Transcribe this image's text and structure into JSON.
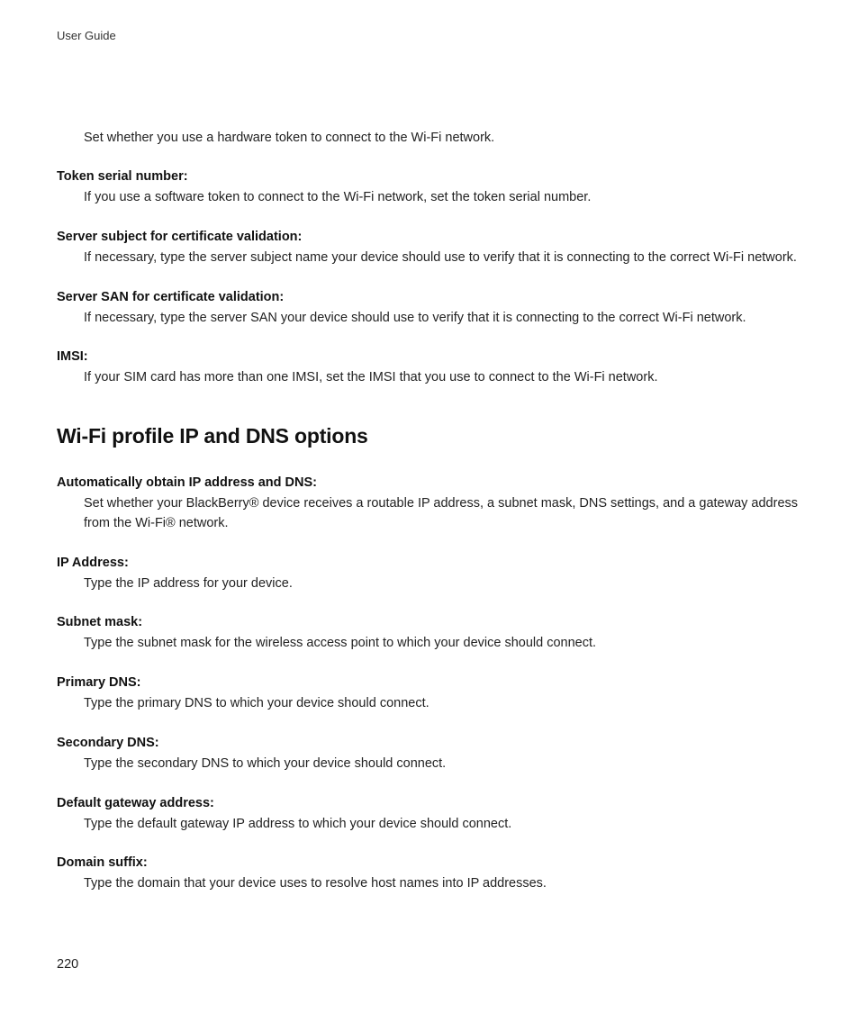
{
  "header": "User Guide",
  "orphan_desc": "Set whether you use a hardware token to connect to the Wi-Fi network.",
  "items1": [
    {
      "label": "Token serial number:",
      "desc": "If you use a software token to connect to the Wi-Fi network, set the token serial number."
    },
    {
      "label": "Server subject for certificate validation:",
      "desc": "If necessary, type the server subject name your device should use to verify that it is connecting to the correct Wi-Fi network."
    },
    {
      "label": "Server SAN for certificate validation:",
      "desc": "If necessary, type the server SAN your device should use to verify that it is connecting to the correct Wi-Fi network."
    },
    {
      "label": "IMSI:",
      "desc": "If your SIM card has more than one IMSI, set the IMSI that you use to connect to the Wi-Fi network."
    }
  ],
  "section_heading": "Wi-Fi profile IP and DNS options",
  "items2": [
    {
      "label": "Automatically obtain IP address and DNS:",
      "desc": "Set whether your BlackBerry® device receives a routable IP address, a subnet mask, DNS settings, and a gateway address from the Wi-Fi® network."
    },
    {
      "label": "IP Address:",
      "desc": "Type the IP address for your device."
    },
    {
      "label": "Subnet mask:",
      "desc": "Type the subnet mask for the wireless access point to which your device should connect."
    },
    {
      "label": "Primary DNS:",
      "desc": "Type the primary DNS to which your device should connect."
    },
    {
      "label": "Secondary DNS:",
      "desc": "Type the secondary DNS to which your device should connect."
    },
    {
      "label": "Default gateway address:",
      "desc": "Type the default gateway IP address to which your device should connect."
    },
    {
      "label": "Domain suffix:",
      "desc": "Type the domain that your device uses to resolve host names into IP addresses."
    }
  ],
  "page_number": "220"
}
